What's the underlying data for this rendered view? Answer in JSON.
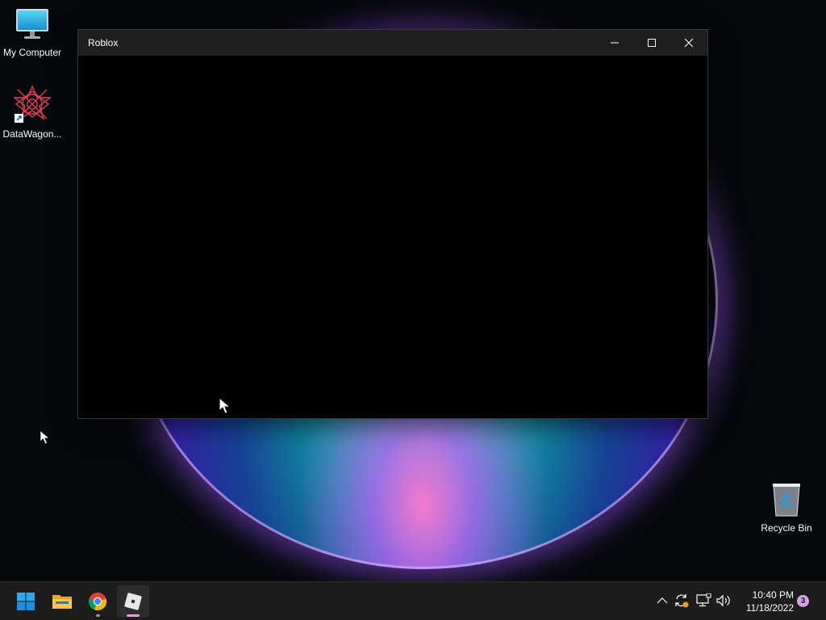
{
  "desktop": {
    "icons": [
      {
        "label": "My Computer",
        "icon": "computer-monitor-icon"
      },
      {
        "label": "DataWagon...",
        "icon": "datawagon-shortcut-icon"
      },
      {
        "label": "Recycle Bin",
        "icon": "recycle-bin-icon"
      }
    ]
  },
  "window": {
    "title": "Roblox",
    "buttons": [
      "minimize-icon",
      "maximize-icon",
      "close-icon"
    ]
  },
  "taskbar": {
    "pinned": [
      {
        "name": "start",
        "icon": "windows-logo-icon"
      },
      {
        "name": "file-explorer",
        "icon": "folder-icon"
      },
      {
        "name": "chrome",
        "icon": "chrome-icon"
      },
      {
        "name": "roblox",
        "icon": "roblox-icon"
      }
    ],
    "tray": {
      "icons": [
        "chevron-up-icon",
        "sync-icon",
        "network-icon",
        "volume-icon"
      ],
      "time": "10:40 PM",
      "date": "11/18/2022",
      "notification_count": "3"
    }
  },
  "colors": {
    "taskbar_bg": "#1c1c1c",
    "titlebar_bg": "#1f1f1f",
    "window_content": "#000000",
    "notif_badge": "#d6a3e6"
  }
}
